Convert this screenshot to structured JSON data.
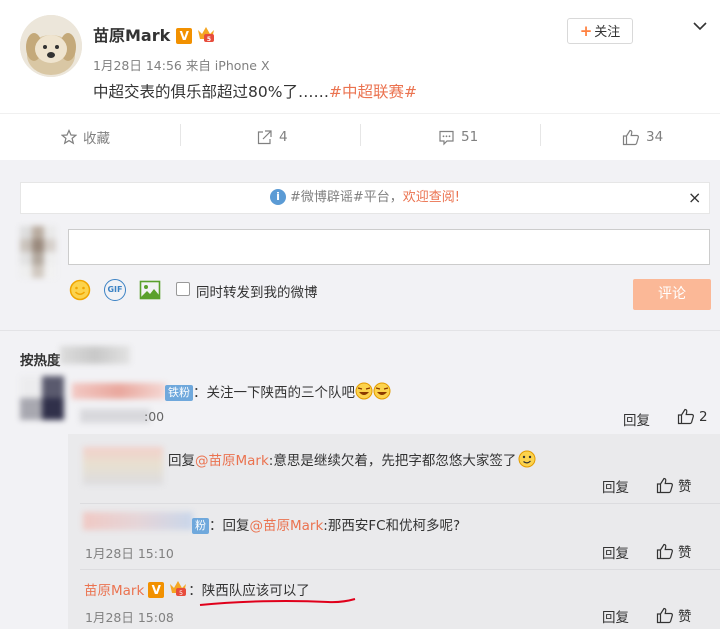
{
  "post": {
    "author": "苗原Mark",
    "verified_badge": "V",
    "meta": "1月28日 14:56 来自 iPhone X",
    "text_main": "中超交表的俱乐部超过80%了……",
    "hashtag": "#中超联赛#",
    "follow_label": "关注",
    "follow_plus": "+"
  },
  "actions": {
    "collect": "收藏",
    "repost_count": "4",
    "comment_count": "51",
    "like_count": "34"
  },
  "notice": {
    "text_gray": "#微博辟谣#平台，",
    "text_orange": "欢迎查阅!",
    "close": "×",
    "info": "i"
  },
  "composer": {
    "input_value": "",
    "sync_label": "同时转发到我的微博",
    "submit_label": "评论",
    "gif_label": "GIF"
  },
  "comments_header": {
    "sort_label": "按热度"
  },
  "comments": [
    {
      "badge": "铁粉",
      "text": "：关注一下陕西的三个队吧",
      "time": ":00",
      "reply": "回复",
      "likes": "2"
    }
  ],
  "replies": [
    {
      "prefix": "回复",
      "mention": "@苗原Mark",
      "text": ":意思是继续欠着，先把字都忽悠大家签了",
      "reply": "回复",
      "like": "赞"
    },
    {
      "badge": "粉",
      "prefix": "：回复",
      "mention": "@苗原Mark",
      "text": ":那西安FC和优柯多呢?",
      "time": "1月28日 15:10",
      "reply": "回复",
      "like": "赞"
    },
    {
      "author": "苗原Mark",
      "verified_badge": "V",
      "text": "：陕西队应该可以了",
      "time": "1月28日 15:08",
      "reply": "回复",
      "like": "赞"
    }
  ],
  "colors": {
    "accent": "#eb7350",
    "muted": "#808080",
    "submit_bg": "#fbb897",
    "verified": "#f29100",
    "annotation": "#e0001b"
  }
}
